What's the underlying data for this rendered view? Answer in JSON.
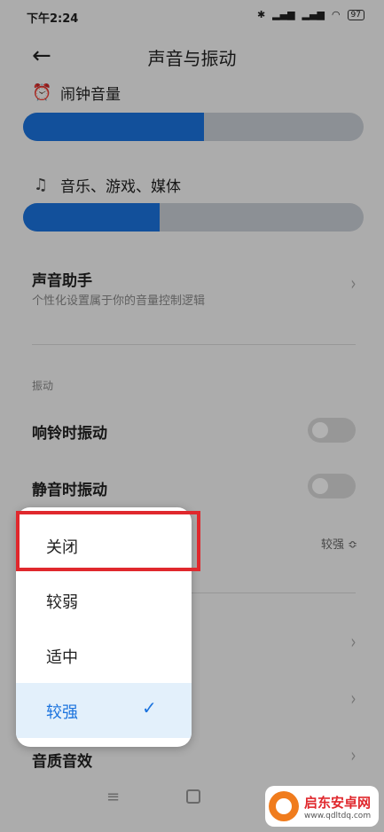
{
  "status": {
    "time": "下午2:24",
    "battery": "97"
  },
  "header": {
    "title": "声音与振动",
    "back": "←"
  },
  "alarm": {
    "label": "闹钟音量",
    "level": 0.53
  },
  "media": {
    "label": "音乐、游戏、媒体",
    "level": 0.4
  },
  "assistant": {
    "title": "声音助手",
    "subtitle": "个性化设置属于你的音量控制逻辑"
  },
  "vibration": {
    "section": "振动",
    "ring": "响铃时振动",
    "silent": "静音时振动",
    "strength_value": "较强 ≎"
  },
  "sound_quality": "音质音效",
  "popup": {
    "options": [
      "关闭",
      "较弱",
      "适中",
      "较强"
    ],
    "selected_index": 3,
    "check": "✓"
  },
  "nav": {
    "menu": "≡"
  },
  "watermark": {
    "name": "启东安卓网",
    "url": "www.qdltdq.com"
  },
  "colors": {
    "accent": "#1b73de",
    "highlight": "#e0282d"
  }
}
